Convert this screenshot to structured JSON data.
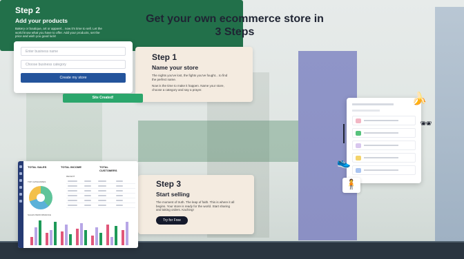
{
  "headline": {
    "line1": "Get your own ecommerce store in",
    "line2": "3 Steps"
  },
  "step1": {
    "title": "Step 1",
    "subtitle": "Name your store",
    "body1": "The nights you've lost, the fights you've fought... to find the perfect name.",
    "body2": "Now is the time to make it happen. Name your store, choose a category and say a prayer.",
    "form": {
      "business_name_placeholder": "Enter business name",
      "category_placeholder": "Choose business category",
      "create_button": "Create my store"
    },
    "site_created": "Site Created!"
  },
  "step2": {
    "title": "Step 2",
    "subtitle": "Add your products",
    "body": "Bakery or boutique, art or apparel... now it's time to sell. Let the world know what you have to offer. Add your products, set the price and wish you good luck!"
  },
  "step3": {
    "title": "Step 3",
    "subtitle": "Start selling",
    "body": "The moment of truth. The leap of faith. This is where it all begins. Your store is ready for the world. Start sharing and taking orders. Kaching!",
    "button": "Try for Free"
  },
  "dashboard": {
    "kpi1": "TOTAL SALES",
    "kpi2": "TOTAL INCOME",
    "kpi3": "TOTAL CUSTOMERS",
    "pie_title": "TOP CATEGORIES",
    "table_title": "RECENT",
    "chart_title": "SALES PERFORMANCE"
  },
  "colors": {
    "step2_bg": "#22704a",
    "create_btn": "#24549c",
    "site_created": "#2ba66c",
    "purple_bg": "#8f95c8"
  },
  "icons": [
    "banana-icon",
    "sneaker-icon",
    "sunglasses-icon",
    "person-icon"
  ]
}
